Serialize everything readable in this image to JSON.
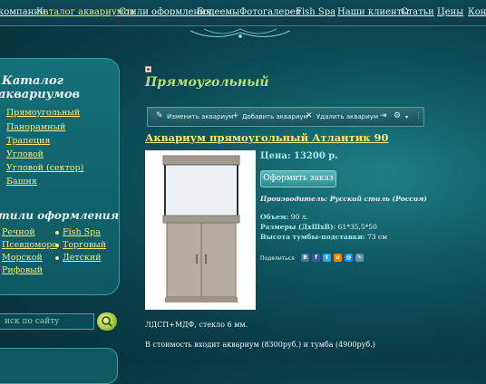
{
  "topnav": {
    "items": [
      "компании",
      "Каталог аквариумов",
      "Стили оформления",
      "Бодеемы",
      "Фотогалерея",
      "Fish Spa",
      "Наши клиенты",
      "Статьи",
      "Цены",
      "Конт"
    ]
  },
  "sidebar": {
    "catalog_title_1": "Каталог",
    "catalog_title_2": "аквариумов",
    "catalog_links": [
      "Прямоугольный",
      "Панорамный",
      "Трапеция",
      "Угловой",
      "Угловой (сектор)",
      "Башня"
    ],
    "styles_title": "тили оформления",
    "styles_left": [
      "Речной",
      "Псевдоморе",
      "Морской",
      "Рифовый"
    ],
    "styles_right": [
      "Fish Spa",
      "Торговый",
      "Детский"
    ]
  },
  "search": {
    "placeholder": "иск по сайту"
  },
  "page": {
    "title": "Прямоугольный"
  },
  "toolbar": {
    "edit": "Изменить аквариум",
    "add": "Добавить аквариум",
    "delete": "Удалить аквариум"
  },
  "product": {
    "title": "Аквариум прямоугольный Атлантик 90",
    "price": "Цена: 13200 р.",
    "order_label": "Оформить заказ",
    "maker": "Производитель: Русский стиль (Россия)",
    "volume_label": "Объем:",
    "volume_value": "90 л.",
    "size_label": "Размеры (ДхШхВ):",
    "size_value": "61*35,5*50",
    "stand_label": "Высота тумбы-подставки:",
    "stand_value": "73 см",
    "share_label": "Поделиться",
    "desc1": "ЛДСП+МДФ, стекло 6 мм.",
    "desc2": "В стоимость входит аквариум (8300руб.) и тумба (4900руб.)"
  },
  "colors": {
    "accent_yellow": "#f3e77d",
    "title_green": "#b8e07a",
    "price_cyan": "#a6e9ea",
    "background": "#0f5a64"
  },
  "icons": [
    "pencil-icon",
    "plus-icon",
    "close-icon",
    "gear-icon",
    "search-icon"
  ]
}
